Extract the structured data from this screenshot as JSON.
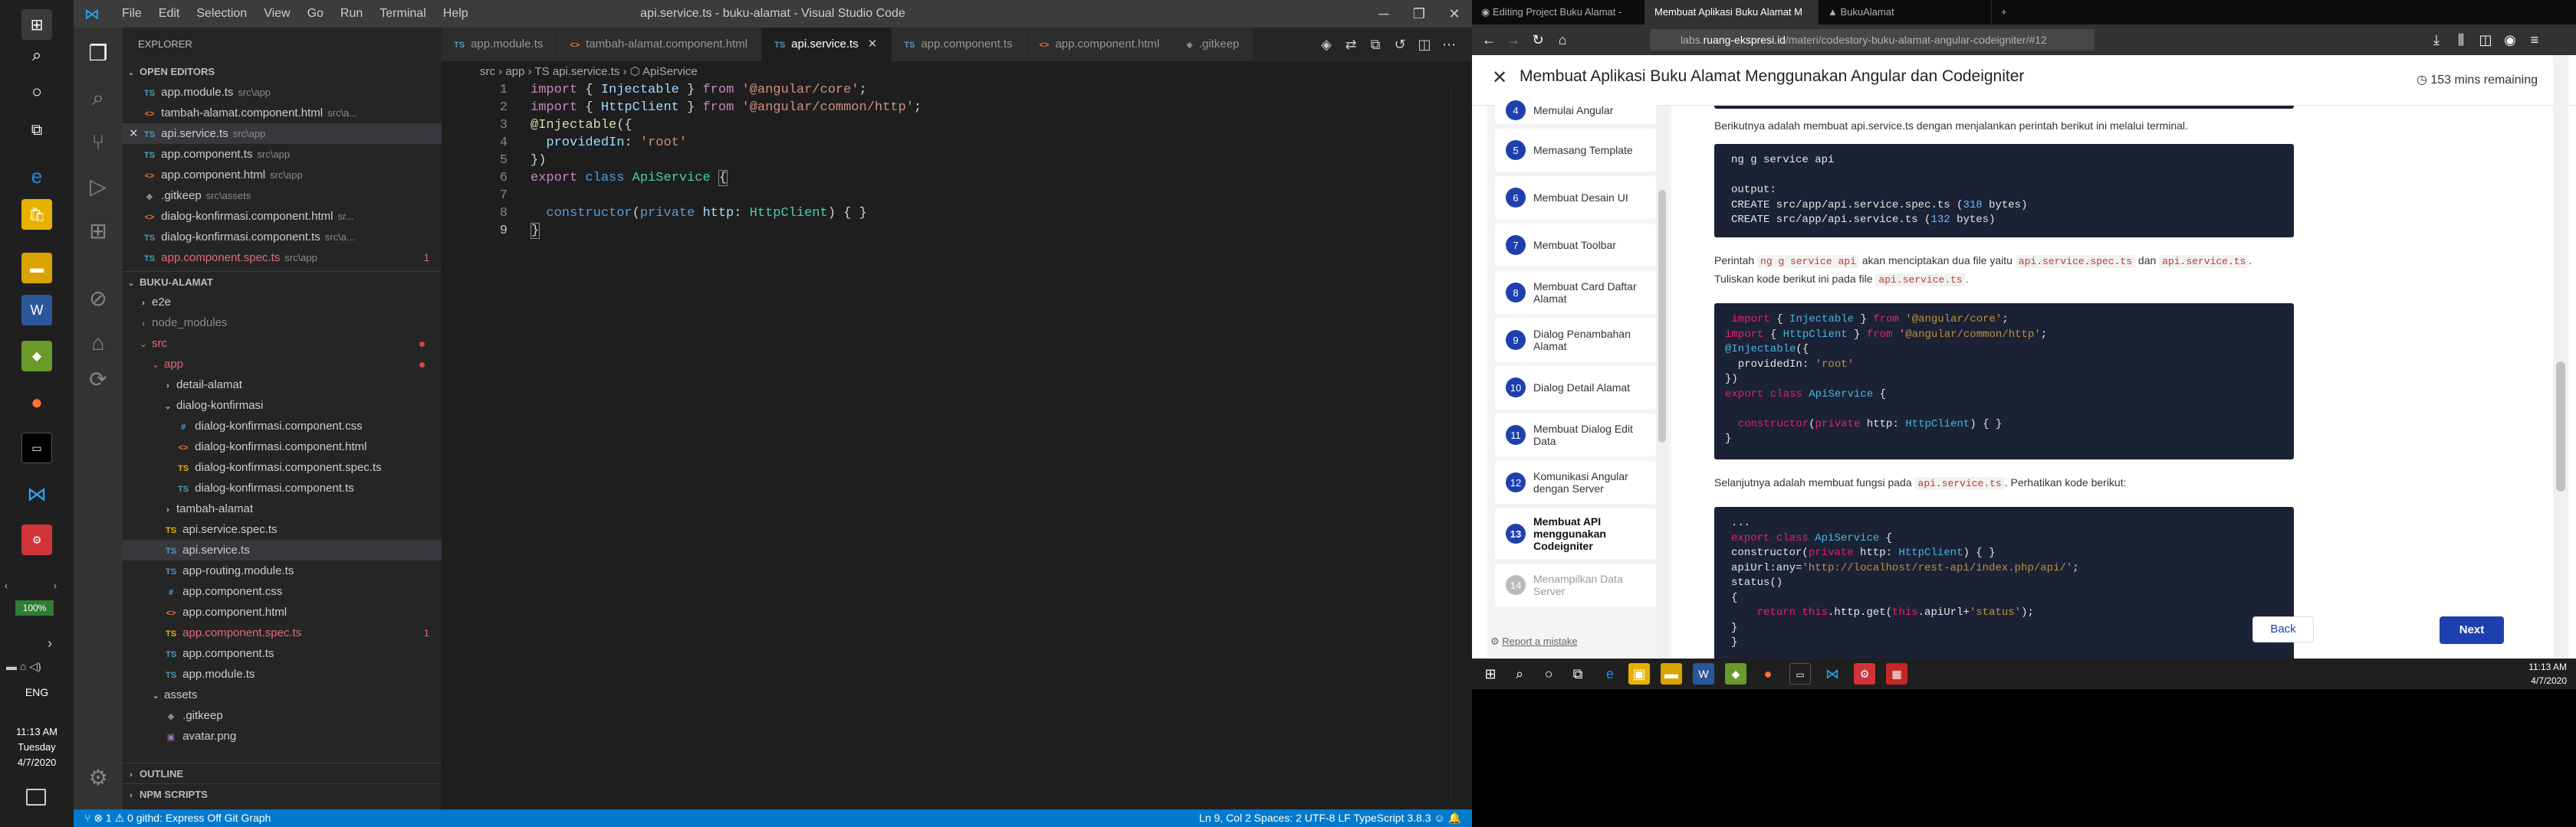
{
  "taskbar_left": {
    "zoom": "100%",
    "lang": "ENG",
    "time": "11:13 AM",
    "day": "Tuesday",
    "date": "4/7/2020"
  },
  "vscode": {
    "title": "api.service.ts - buku-alamat - Visual Studio Code",
    "menu": [
      "File",
      "Edit",
      "Selection",
      "View",
      "Go",
      "Run",
      "Terminal",
      "Help"
    ],
    "explorer_label": "EXPLORER",
    "open_editors_label": "OPEN EDITORS",
    "open_editors": [
      {
        "icon": "TS",
        "name": "app.module.ts",
        "desc": "src\\app"
      },
      {
        "icon": "<>",
        "name": "tambah-alamat.component.html",
        "desc": "src\\a..."
      },
      {
        "icon": "TS",
        "name": "api.service.ts",
        "desc": "src\\app"
      },
      {
        "icon": "TS",
        "name": "app.component.ts",
        "desc": "src\\app"
      },
      {
        "icon": "<>",
        "name": "app.component.html",
        "desc": "src\\app"
      },
      {
        "icon": "◆",
        "name": ".gitkeep",
        "desc": "src\\assets"
      },
      {
        "icon": "<>",
        "name": "dialog-konfirmasi.component.html",
        "desc": "sr..."
      },
      {
        "icon": "TS",
        "name": "dialog-konfirmasi.component.ts",
        "desc": "src\\a..."
      },
      {
        "icon": "TS",
        "name": "app.component.spec.ts",
        "desc": "src\\app",
        "badge": "1"
      }
    ],
    "project_label": "BUKU-ALAMAT",
    "tree": [
      {
        "name": "e2e"
      },
      {
        "name": "node_modules"
      },
      {
        "name": "src"
      },
      {
        "name": "app"
      },
      {
        "name": "detail-alamat"
      },
      {
        "name": "dialog-konfirmasi"
      },
      {
        "icon": "#",
        "name": "dialog-konfirmasi.component.css"
      },
      {
        "icon": "<>",
        "name": "dialog-konfirmasi.component.html"
      },
      {
        "icon": "TS",
        "name": "dialog-konfirmasi.component.spec.ts"
      },
      {
        "icon": "TS",
        "name": "dialog-konfirmasi.component.ts"
      },
      {
        "name": "tambah-alamat"
      },
      {
        "icon": "TS",
        "name": "api.service.spec.ts"
      },
      {
        "icon": "TS",
        "name": "api.service.ts"
      },
      {
        "icon": "TS",
        "name": "app-routing.module.ts"
      },
      {
        "icon": "#",
        "name": "app.component.css"
      },
      {
        "icon": "<>",
        "name": "app.component.html"
      },
      {
        "icon": "TS",
        "name": "app.component.spec.ts",
        "badge": "1"
      },
      {
        "icon": "TS",
        "name": "app.component.ts"
      },
      {
        "icon": "TS",
        "name": "app.module.ts"
      },
      {
        "name": "assets"
      },
      {
        "icon": "◆",
        "name": ".gitkeep"
      },
      {
        "icon": "▣",
        "name": "avatar.png"
      }
    ],
    "outline_label": "OUTLINE",
    "npm_label": "NPM SCRIPTS",
    "tabs": [
      {
        "icon": "TS",
        "name": "app.module.ts"
      },
      {
        "icon": "<>",
        "name": "tambah-alamat.component.html"
      },
      {
        "icon": "TS",
        "name": "api.service.ts"
      },
      {
        "icon": "TS",
        "name": "app.component.ts"
      },
      {
        "icon": "<>",
        "name": "app.component.html"
      },
      {
        "icon": "◆",
        "name": ".gitkeep"
      }
    ],
    "breadcrumb": "src › app › TS api.service.ts › ⬡ ApiService",
    "line_numbers": [
      "1",
      "2",
      "3",
      "4",
      "5",
      "6",
      "7",
      "8",
      "9"
    ],
    "status_left": "⑂  ⊗ 1 ⚠ 0    githd: Express Off    Git Graph",
    "status_right": "Ln 9, Col 2    Spaces: 2    UTF-8    LF    TypeScript    3.8.3    ☺   🔔"
  },
  "firefox": {
    "tabs": [
      "Editing Project Buku Alamat -",
      "Membuat Aplikasi Buku Alamat M",
      "BukuAlamat"
    ],
    "url_dim": "labs.",
    "url_host": "ruang-ekspresi.id",
    "url_path": "/materi/codestory-buku-alamat-angular-codeigniter/#12",
    "page_title": "Membuat Aplikasi Buku Alamat Menggunakan Angular dan Codeigniter",
    "time_remaining": "153 mins remaining",
    "steps": [
      {
        "n": "4",
        "t": "Memulai Angular"
      },
      {
        "n": "5",
        "t": "Memasang Template"
      },
      {
        "n": "6",
        "t": "Membuat Desain UI"
      },
      {
        "n": "7",
        "t": "Membuat Toolbar"
      },
      {
        "n": "8",
        "t": "Membuat Card Daftar Alamat"
      },
      {
        "n": "9",
        "t": "Dialog Penambahan Alamat"
      },
      {
        "n": "10",
        "t": "Dialog Detail Alamat"
      },
      {
        "n": "11",
        "t": "Membuat Dialog Edit Data"
      },
      {
        "n": "12",
        "t": "Komunikasi Angular dengan Server"
      },
      {
        "n": "13",
        "t": "Membuat API menggunakan Codeigniter"
      },
      {
        "n": "14",
        "t": "Menampilkan Data Server"
      }
    ],
    "report": "Report a mistake",
    "p1": "Berikutnya adalah membuat api.service.ts dengan menjalankan perintah berikut ini melalui terminal.",
    "p2_a": "Perintah ",
    "p2_code1": "ng g service api",
    "p2_b": " akan menciptakan dua file yaitu ",
    "p2_code2": "api.service.spec.ts",
    "p2_c": " dan ",
    "p2_code3": "api.service.ts",
    "p2_d": ".",
    "p3_a": "Tuliskan kode berikut ini pada file ",
    "p3_code": "api.service.ts",
    "p3_b": ".",
    "p4_a": "Selanjutnya adalah membuat fungsi pada ",
    "p4_code": "api.service.ts",
    "p4_b": ". Perhatikan kode berikut:",
    "back": "Back",
    "next": "Next",
    "clock_time": "11:13 AM",
    "clock_date": "4/7/2020"
  }
}
